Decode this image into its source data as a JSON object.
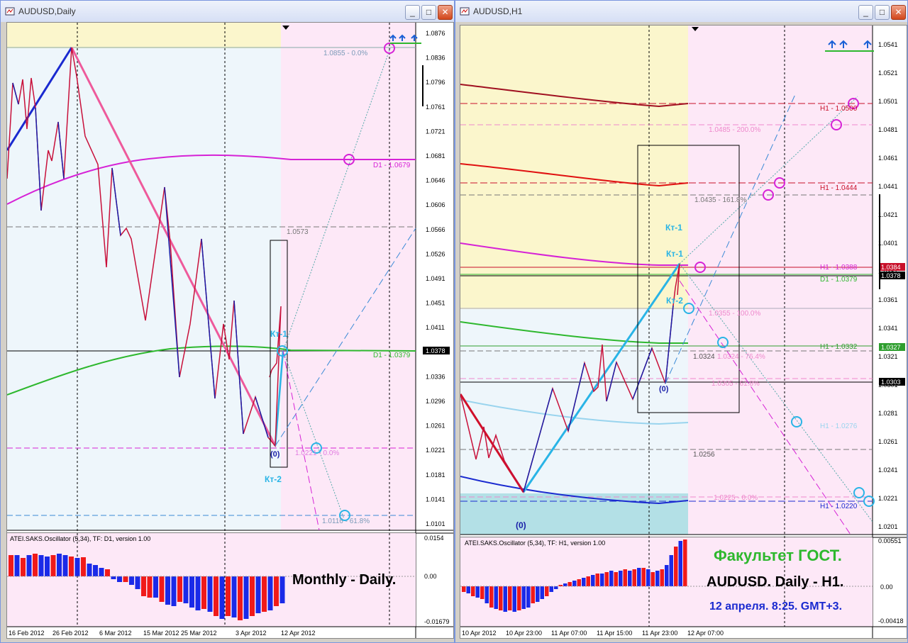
{
  "colors": {
    "bg_pink": "#fde8f7",
    "bg_yellow": "#fbf6cc",
    "bg_blue": "#eef6fb",
    "bg_teal": "#b3e0e6",
    "up_line": "#1a1fa8",
    "down_line": "#d0103a",
    "magenta": "#d622d6",
    "green": "#2eb82e",
    "cyan": "#1fb8e8"
  },
  "left": {
    "title": "AUDUSD,Daily",
    "buttons": [
      "_",
      "□",
      "✕"
    ],
    "price_labels": [
      "1.0876",
      "1.0836",
      "1.0796",
      "1.0761",
      "1.0721",
      "1.0681",
      "1.0646",
      "1.0606",
      "1.0566",
      "1.0526",
      "1.0491",
      "1.0451",
      "1.0411",
      "1.0371",
      "1.0336",
      "1.0296",
      "1.0261",
      "1.0221",
      "1.0181",
      "1.0141",
      "1.0101"
    ],
    "current_price": "1.0378",
    "date_labels": [
      "16 Feb 2012",
      "26 Feb 2012",
      "6 Mar 2012",
      "15 Mar 2012",
      "25 Mar 2012",
      "3 Apr 2012",
      "12 Apr 2012"
    ],
    "annotations": {
      "fib_top": "1.0855 - 0.0%",
      "d1_top": "D1 - 1.0679",
      "level_1": "1.0573",
      "d1_mid": "D1 - 1.0379",
      "fib_zero": "1.0221 - 0.0%",
      "fib_618": "1.0116 - 61.8%",
      "kt1": "Кт-1",
      "kt2": "Кт-2",
      "zero": "(0)"
    },
    "osc_title": "ATEI.SAKS.Oscillator (5,34), TF: D1, version 1.00",
    "osc_labels": [
      "0.0154",
      "0.00",
      "-0.01679"
    ],
    "caption": "Monthly - Daily."
  },
  "right": {
    "title": "AUDUSD,H1",
    "buttons": [
      "_",
      "□",
      "✕"
    ],
    "price_labels": [
      "1.0541",
      "1.0521",
      "1.0501",
      "1.0481",
      "1.0461",
      "1.0441",
      "1.0421",
      "1.0401",
      "1.0381",
      "1.0361",
      "1.0341",
      "1.0321",
      "1.0301",
      "1.0281",
      "1.0261",
      "1.0241",
      "1.0221",
      "1.0201"
    ],
    "badges": [
      "1.0384",
      "1.0378",
      "1.0327",
      "1.0303"
    ],
    "date_labels": [
      "10 Apr 2012",
      "10 Apr 23:00",
      "11 Apr 07:00",
      "11 Apr 15:00",
      "11 Apr 23:00",
      "12 Apr 07:00"
    ],
    "annotations": {
      "h1_1": "H1 - 1.0500",
      "fib_200": "1.0485 - 200.0%",
      "h1_2": "H1 - 1.0444",
      "fib_161": "1.0435 - 161.8%",
      "h1_3": "H1 - 1.0388",
      "d1": "D1 - 1.0379",
      "fib_100": "1.0355 - 100.0%",
      "h1_4": "H1 - 1.0332",
      "lvl_1": "1.0324",
      "fib_764": "1.0324 - 76.4%",
      "fib_618": "1.0305 - 61.8%",
      "h1_5": "H1 - 1.0276",
      "lvl_2": "1.0256",
      "fib_0": "1.0225 - 0.0%",
      "h1_6": "H1 - 1.0220",
      "kt1a": "Кт-1",
      "kt1b": "Кт-1",
      "kt2": "Кт-2",
      "zero_a": "(0)",
      "zero_b": "(0)"
    },
    "osc_title": "ATEI.SAKS.Oscillator (5,34), TF: H1, version 1.00",
    "osc_labels": [
      "0.00551",
      "0.00",
      "-0.00418"
    ],
    "caption1": "Факультет ГОСТ.",
    "caption2": "AUDUSD. Daily - H1.",
    "caption3": "12 апреля. 8:25. GMT+3."
  }
}
